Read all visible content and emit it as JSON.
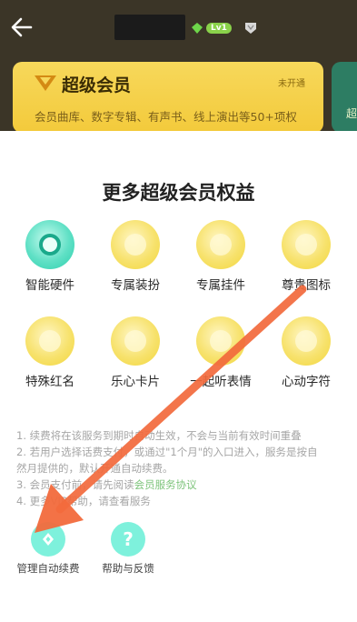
{
  "header": {
    "level_badge": "Lv1",
    "back_icon": "arrow-left-icon",
    "gem_icon": "gem-icon",
    "shield_icon": "shield-icon"
  },
  "membership_card": {
    "title": "超级会员",
    "status": "未开通",
    "description": "会员曲库、数字专辑、有声书、线上演出等50+项权",
    "icon": "v-crown-icon"
  },
  "next_card": {
    "partial_text": "超"
  },
  "benefits": {
    "heading": "更多超级会员权益",
    "items": [
      {
        "label": "智能硬件",
        "icon": "smart-hardware-icon"
      },
      {
        "label": "专属装扮",
        "icon": "exclusive-dress-icon"
      },
      {
        "label": "专属挂件",
        "icon": "exclusive-pendant-icon"
      },
      {
        "label": "尊贵图标",
        "icon": "noble-icon"
      },
      {
        "label": "特殊红名",
        "icon": "special-red-name-icon"
      },
      {
        "label": "乐心卡片",
        "icon": "music-heart-card-icon"
      },
      {
        "label": "一起听表情",
        "icon": "listen-together-emoji-icon"
      },
      {
        "label": "心动字符",
        "icon": "heartbeat-character-icon"
      }
    ]
  },
  "notes": {
    "line1": "1. 续费将在该服务到期时自动生效，不会与当前有效时间重叠",
    "line2a": "2. 若用户选择话费支付，或通过\"1个月\"的入口进入，服务是按自",
    "line2b": "然月提供的，默认开通自动续费。",
    "line3_prefix": "3. 会员支付前，请先阅读",
    "line3_link": "会员服务协议",
    "line4": "4. 更多VIP帮助，请查看服务"
  },
  "actions": {
    "manage_autorenew": "管理自动续费",
    "help_feedback": "帮助与反馈",
    "help_symbol": "?"
  },
  "colors": {
    "top_bg": "#3b3527",
    "card_gold": "#f3ca3b",
    "accent_mint": "#7ef1dc",
    "arrow_orange": "#f26a3c",
    "link_green": "#7ec47b"
  }
}
